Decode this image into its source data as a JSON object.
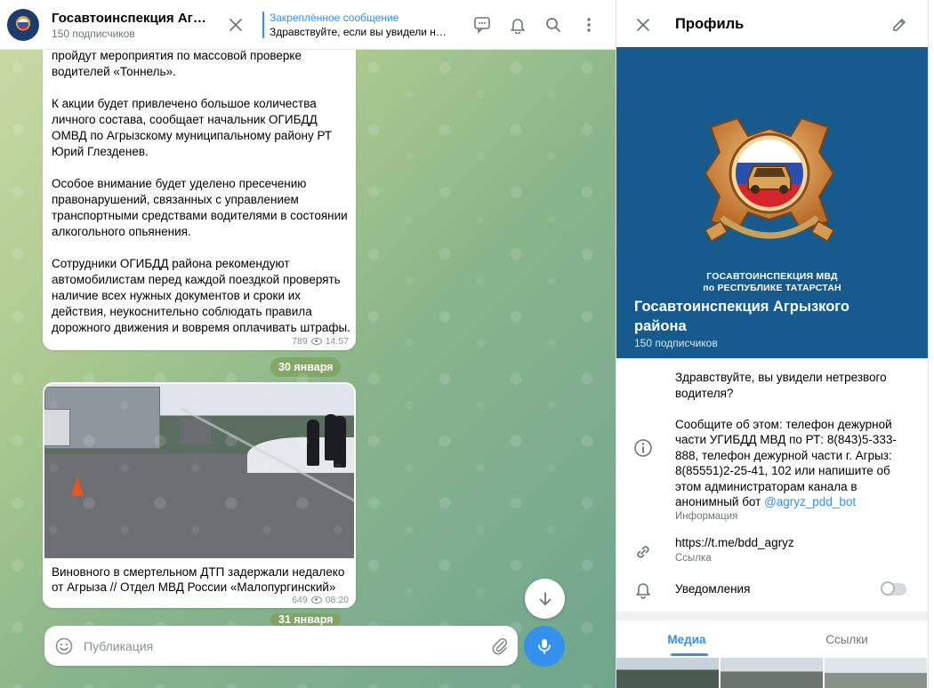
{
  "chat": {
    "title": "Госавтоинспекция Агрыз…",
    "subscribers": "150 подписчиков",
    "pinned_label": "Закреплённое сообщение",
    "pinned_text": "Здравствуйте, если вы увидели не…"
  },
  "messages": [
    {
      "text": "пройдут мероприятия по массовой проверке водителей «Тоннель».\n\nК акции будет привлечено большое количества личного состава, сообщает начальник ОГИБДД ОМВД по Агрызскому муниципальному району РТ Юрий Глезденев.\n\nОсобое внимание будет уделено пресечению правонарушений, связанных с управлением транспортными средствами водителями в состоянии алкогольного опьянения.\n\nСотрудники ОГИБДД района рекомендуют автомобилистам перед каждой поездкой проверять наличие всех нужных документов и сроки их действия, неукоснительно соблюдать правила дорожного движения и вовремя оплачивать штрафы.",
      "views": "789",
      "time": "14:57"
    },
    {
      "text": "Виновного в смертельном ДТП задержали недалеко от Агрыза // Отдел МВД России «Малопургинский»",
      "views": "649",
      "time": "08:20"
    }
  ],
  "date_separators": [
    "30 января",
    "31 января"
  ],
  "composer": {
    "placeholder": "Публикация"
  },
  "profile": {
    "header_title": "Профиль",
    "cover_brand_line1": "ГОСАВТОИНСПЕКЦИЯ МВД",
    "cover_brand_line2": "по РЕСПУБЛИКЕ ТАТАРСТАН",
    "name": "Госавтоинспекция Агрызкого района",
    "subscribers": "150 подписчиков",
    "info_text": "Здравствуйте, вы увидели нетрезвого водителя?\n\nСообщите об этом: телефон дежурной части УГИБДД МВД по РТ: 8(843)5-333-888, телефон дежурной части г. Агрыз: 8(85551)2-25-41, 102 или напишите об этом администраторам канала в анонимный бот ",
    "info_link": "@agryz_pdd_bot",
    "info_caption": "Информация",
    "link_url": "https://t.me/bdd_agryz",
    "link_caption": "Ссылка",
    "notifications_label": "Уведомления",
    "notifications_on": false,
    "tabs": [
      "Медиа",
      "Ссылки"
    ]
  },
  "colors": {
    "accent": "#3390ec",
    "cover": "#175a8e",
    "muted": "#707579"
  },
  "icons": [
    "close-icon",
    "discussion-icon",
    "bell-icon",
    "search-icon",
    "more-icon",
    "arrow-down-icon",
    "emoji-icon",
    "attach-icon",
    "mic-icon",
    "edit-icon",
    "info-icon",
    "link-icon",
    "eye-icon"
  ]
}
